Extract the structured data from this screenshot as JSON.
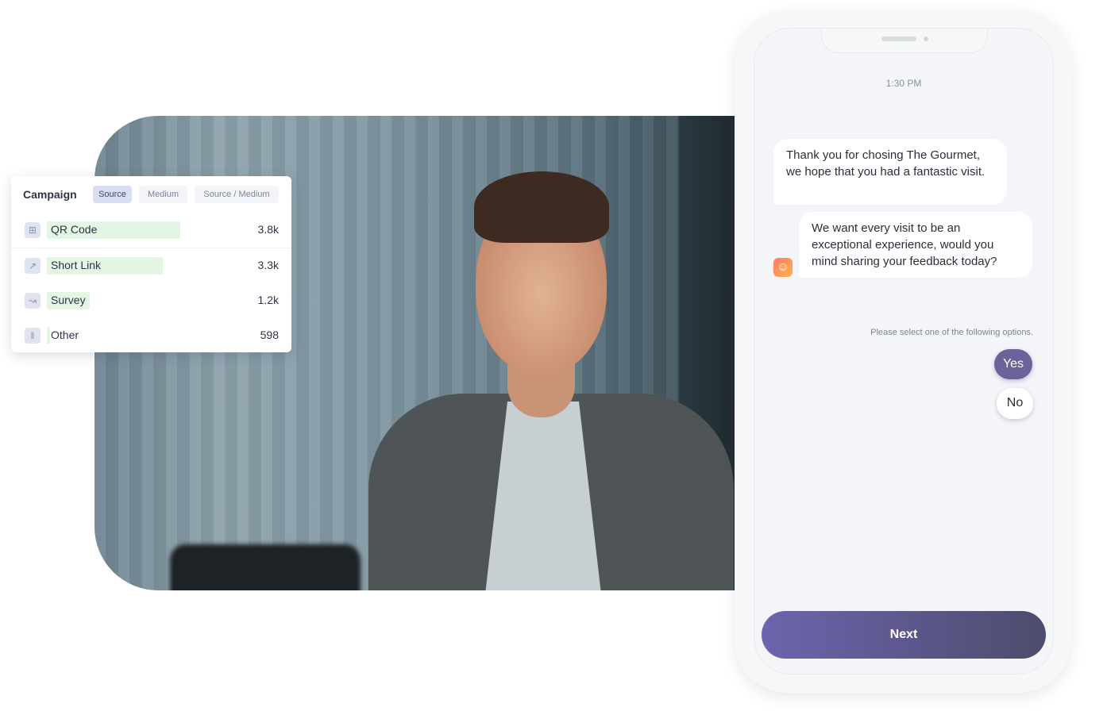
{
  "campaign_card": {
    "title": "Campaign",
    "tabs": [
      {
        "label": "Source",
        "active": true
      },
      {
        "label": "Medium",
        "active": false
      },
      {
        "label": "Source / Medium",
        "active": false
      }
    ],
    "rows": [
      {
        "label": "QR Code",
        "value": "3.8k",
        "icon": "qr-code-icon",
        "share": 1.0
      },
      {
        "label": "Short Link",
        "value": "3.3k",
        "icon": "link-chart-icon",
        "share": 0.87
      },
      {
        "label": "Survey",
        "value": "1.2k",
        "icon": "survey-chart-icon",
        "share": 0.32
      },
      {
        "label": "Other",
        "value": "598",
        "icon": "other-icon",
        "share": 0.02
      }
    ],
    "colors": {
      "bar": "#e2f6e3",
      "active_tab": "#d9dff0"
    }
  },
  "phone": {
    "time": "1:30 PM",
    "messages": [
      {
        "text": "Thank you for chosing The Gourmet, we hope that you had a fantastic visit."
      },
      {
        "text": "We want every visit to be an exceptional experience, would you mind sharing your feedback today?"
      }
    ],
    "bot_avatar": "smiley-avatar-icon",
    "prompt": "Please select one of the following options.",
    "options": [
      {
        "label": "Yes",
        "selected": true
      },
      {
        "label": "No",
        "selected": false
      }
    ],
    "next_label": "Next",
    "colors": {
      "accent": "#6a649b",
      "button_from": "#6d64ae",
      "button_to": "#4e4c6c"
    }
  }
}
